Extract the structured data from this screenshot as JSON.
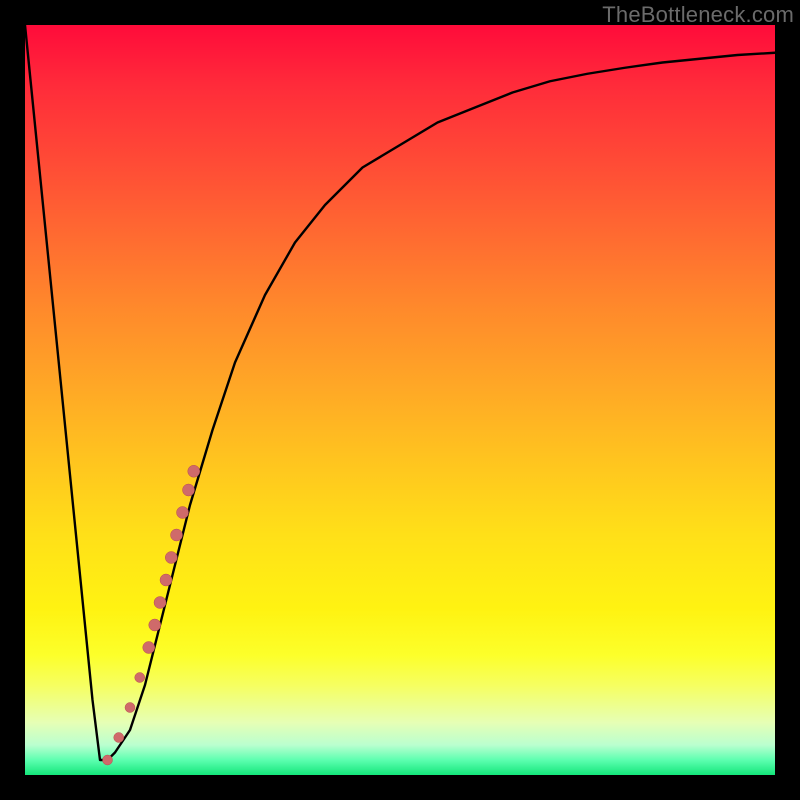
{
  "watermark": "TheBottleneck.com",
  "colors": {
    "curve_stroke": "#000000",
    "marker_fill": "#cf6a6a",
    "marker_stroke": "#b84f4f"
  },
  "chart_data": {
    "type": "line",
    "title": "",
    "xlabel": "",
    "ylabel": "",
    "xlim": [
      0,
      100
    ],
    "ylim": [
      0,
      100
    ],
    "grid": false,
    "legend": false,
    "annotations": [],
    "series": [
      {
        "name": "bottleneck-curve",
        "x": [
          0,
          2,
          4,
          6,
          8,
          9,
          10,
          11,
          12,
          14,
          16,
          18,
          20,
          22,
          25,
          28,
          32,
          36,
          40,
          45,
          50,
          55,
          60,
          65,
          70,
          75,
          80,
          85,
          90,
          95,
          100
        ],
        "y": [
          100,
          80,
          60,
          40,
          20,
          10,
          2,
          2,
          3,
          6,
          12,
          20,
          28,
          36,
          46,
          55,
          64,
          71,
          76,
          81,
          84,
          87,
          89,
          91,
          92.5,
          93.5,
          94.3,
          95,
          95.5,
          96,
          96.3
        ]
      }
    ],
    "markers": [
      {
        "x": 11.0,
        "y": 2.0,
        "r": 5
      },
      {
        "x": 12.5,
        "y": 5.0,
        "r": 5
      },
      {
        "x": 14.0,
        "y": 9.0,
        "r": 5
      },
      {
        "x": 15.3,
        "y": 13.0,
        "r": 5
      },
      {
        "x": 16.5,
        "y": 17.0,
        "r": 6
      },
      {
        "x": 17.3,
        "y": 20.0,
        "r": 6
      },
      {
        "x": 18.0,
        "y": 23.0,
        "r": 6
      },
      {
        "x": 18.8,
        "y": 26.0,
        "r": 6
      },
      {
        "x": 19.5,
        "y": 29.0,
        "r": 6
      },
      {
        "x": 20.2,
        "y": 32.0,
        "r": 6
      },
      {
        "x": 21.0,
        "y": 35.0,
        "r": 6
      },
      {
        "x": 21.8,
        "y": 38.0,
        "r": 6
      },
      {
        "x": 22.5,
        "y": 40.5,
        "r": 6
      }
    ]
  }
}
